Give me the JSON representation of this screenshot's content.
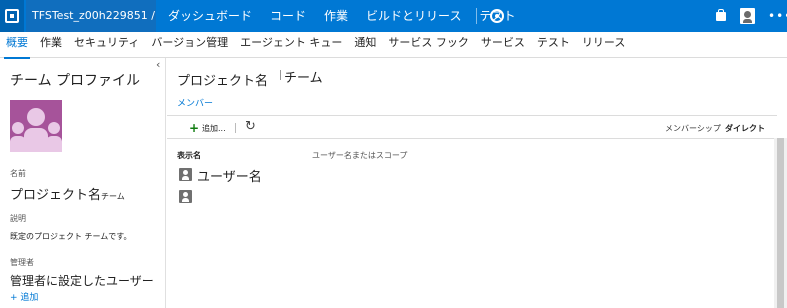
{
  "topbar": {
    "project_title": "TFSTest_z00h229851 / TF...",
    "nav": [
      "ダッシュボード",
      "コード",
      "作業",
      "ビルドとリリース",
      "テスト"
    ],
    "icons": [
      "logo-icon",
      "gear-icon",
      "bag-icon",
      "user-avatar-icon",
      "more-icon"
    ]
  },
  "tabs": {
    "active": "概要",
    "items": [
      "概要",
      "作業",
      "セキュリティ",
      "バージョン管理",
      "エージェント キュー",
      "通知",
      "サービス フック",
      "サービス",
      "テスト",
      "リリース"
    ]
  },
  "left_panel": {
    "title": "チーム プロファイル",
    "name_label": "名前",
    "name_value": "プロジェクト名",
    "name_suffix": "チーム",
    "description_label": "説明",
    "description_value": "既定のプロジェクト チームです。",
    "admins_label": "管理者",
    "admin_value": "管理者に設定したユーザー",
    "add_link": "+ 追加"
  },
  "main": {
    "project_name": "プロジェクト名",
    "team_name": "チーム",
    "members_link": "メンバー",
    "toolbar": {
      "add_label": "追加...",
      "membership_label": "メンバーシップ",
      "membership_value": "ダイレクト"
    },
    "columns": {
      "display_name": "表示名",
      "user_scope": "ユーザー名またはスコープ"
    },
    "rows": [
      {
        "name": "ユーザー名"
      },
      {
        "name": ""
      }
    ]
  },
  "colors": {
    "topbar": "#0078d4",
    "accent": "#0078d4",
    "team_image": "#a6539a",
    "add_green": "#107c10"
  }
}
